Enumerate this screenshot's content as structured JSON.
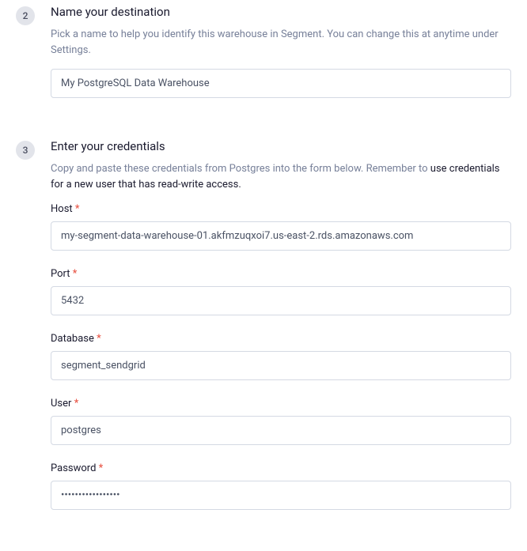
{
  "step2": {
    "number": "2",
    "title": "Name your destination",
    "description": "Pick a name to help you identify this warehouse in Segment. You can change this at anytime under Settings.",
    "destination_name": "My PostgreSQL Data Warehouse"
  },
  "step3": {
    "number": "3",
    "title": "Enter your credentials",
    "description_part1": "Copy and paste these credentials from Postgres into the form below. Remember to ",
    "description_bold": "use credentials for a new user that has read-write access.",
    "fields": {
      "host": {
        "label": "Host",
        "required": "*",
        "value": "my-segment-data-warehouse-01.akfmzuqxoi7.us-east-2.rds.amazonaws.com"
      },
      "port": {
        "label": "Port",
        "required": "*",
        "value": "5432"
      },
      "database": {
        "label": "Database",
        "required": "*",
        "value": "segment_sendgrid"
      },
      "user": {
        "label": "User",
        "required": "*",
        "value": "postgres"
      },
      "password": {
        "label": "Password",
        "required": "*",
        "value": "•••••••••••••••••"
      }
    }
  }
}
